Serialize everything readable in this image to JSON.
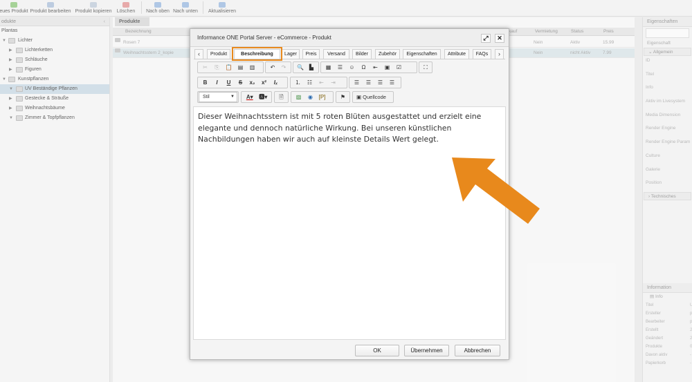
{
  "toolbar": {
    "buttons": [
      "eues Produkt",
      "Produkt bearbeiten",
      "Produkt kopieren",
      "Löschen",
      "Nach oben",
      "Nach unten",
      "Aktualisieren"
    ]
  },
  "left_panel": {
    "title": "odukte",
    "tree": [
      {
        "label": "Plantas"
      },
      {
        "label": "Lichter"
      },
      {
        "label": "Lichterketten"
      },
      {
        "label": "Schläuche"
      },
      {
        "label": "Figuren"
      },
      {
        "label": "Kunstpflanzen"
      },
      {
        "label": "UV Beständige Pflanzen"
      },
      {
        "label": "Gestecke & Sträuße"
      },
      {
        "label": "Weihnachtsbäume"
      },
      {
        "label": "Zimmer & Topfpflanzen"
      }
    ]
  },
  "center": {
    "tab": "Produkte",
    "columns": [
      "Bezeichnung",
      "kauf",
      "Vermietung",
      "Status",
      "Preis"
    ],
    "rows": [
      {
        "name": "Rosen 7",
        "vermietung": "Nein",
        "status": "Aktiv",
        "preis": "15.99"
      },
      {
        "name": "Weihnachtsstern 2_kopie",
        "vermietung": "Nein",
        "status": "nicht Aktiv",
        "preis": "7.99"
      }
    ]
  },
  "right_panel": {
    "title": "Eigenschaften",
    "column": "Eigenschaft",
    "group_general": "Allgemein",
    "properties": [
      "ID",
      "Titel",
      "Info",
      "Aktiv im Livesystem",
      "Media Dimension",
      "Render Engine",
      "Render Engine Param",
      "Culture",
      "Galerie",
      "Position"
    ],
    "group_technical": "Technisches",
    "info_title": "Information",
    "info_tab": "Info",
    "info_rows": [
      {
        "label": "Titel",
        "value": "U"
      },
      {
        "label": "Ersteller",
        "value": "p"
      },
      {
        "label": "Bearbeiter",
        "value": "p"
      },
      {
        "label": "Erstellt",
        "value": "2"
      },
      {
        "label": "Geändert",
        "value": "2"
      },
      {
        "label": "Produkte",
        "value": "0"
      },
      {
        "label": "Davon aktiv",
        "value": "-"
      },
      {
        "label": "Papierkorb",
        "value": "-"
      }
    ]
  },
  "dialog": {
    "title": "Informance ONE Portal Server - eCommerce - Produkt",
    "tabs": [
      "Produkt",
      "Beschreibung",
      "Lager",
      "Preis",
      "Versand",
      "Bilder",
      "Zubehör",
      "Eigenschaften",
      "Attribute",
      "FAQs"
    ],
    "active_tab": "Beschreibung",
    "style_combo": "Stil",
    "source_button": "Quellcode",
    "content": "Dieser Weihnachtsstern ist mit 5 roten Blüten ausgestattet und erzielt eine elegante und dennoch natürliche Wirkung. Bei unseren künstlichen Nachbildungen haben wir auch auf kleinste Details Wert gelegt.",
    "buttons": {
      "ok": "OK",
      "apply": "Übernehmen",
      "cancel": "Abbrechen"
    }
  },
  "colors": {
    "highlight": "#e8891c",
    "arrow": "#e8891c"
  }
}
